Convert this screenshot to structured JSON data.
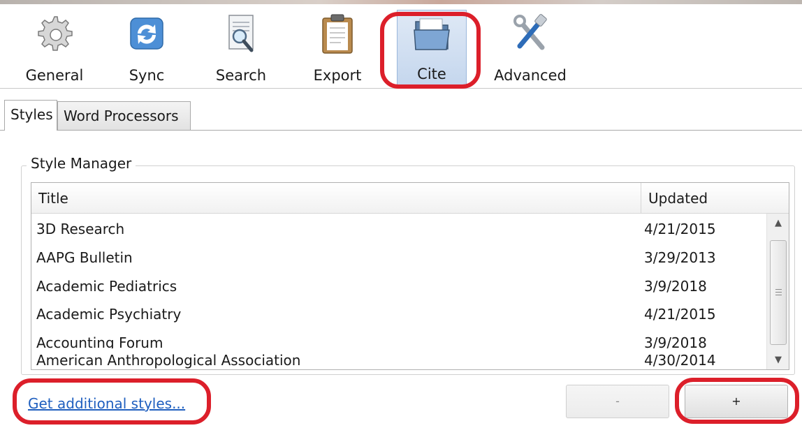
{
  "toolbar": {
    "items": [
      {
        "label": "General",
        "icon": "gear-icon"
      },
      {
        "label": "Sync",
        "icon": "sync-icon"
      },
      {
        "label": "Search",
        "icon": "search-icon"
      },
      {
        "label": "Export",
        "icon": "clipboard-icon"
      },
      {
        "label": "Cite",
        "icon": "folder-icon",
        "selected": true
      },
      {
        "label": "Advanced",
        "icon": "tools-icon"
      }
    ]
  },
  "tabs": [
    {
      "label": "Styles",
      "active": true
    },
    {
      "label": "Word Processors",
      "active": false
    }
  ],
  "style_manager": {
    "title": "Style Manager",
    "columns": {
      "title": "Title",
      "updated": "Updated"
    },
    "rows": [
      {
        "title": "3D Research",
        "updated": "4/21/2015"
      },
      {
        "title": "AAPG Bulletin",
        "updated": "3/29/2013"
      },
      {
        "title": "Academic Pediatrics",
        "updated": "3/9/2018"
      },
      {
        "title": "Academic Psychiatry",
        "updated": "4/21/2015"
      },
      {
        "title": "Accounting Forum",
        "updated": "3/9/2018"
      },
      {
        "title": "American Anthropological Association",
        "updated": "4/30/2014"
      }
    ]
  },
  "footer": {
    "get_styles_link": "Get additional styles...",
    "remove_label": "-",
    "add_label": "+"
  },
  "colors": {
    "highlight": "#dc1f2a",
    "selected_bg": "#c4d6ed",
    "link": "#1f5fbf"
  }
}
